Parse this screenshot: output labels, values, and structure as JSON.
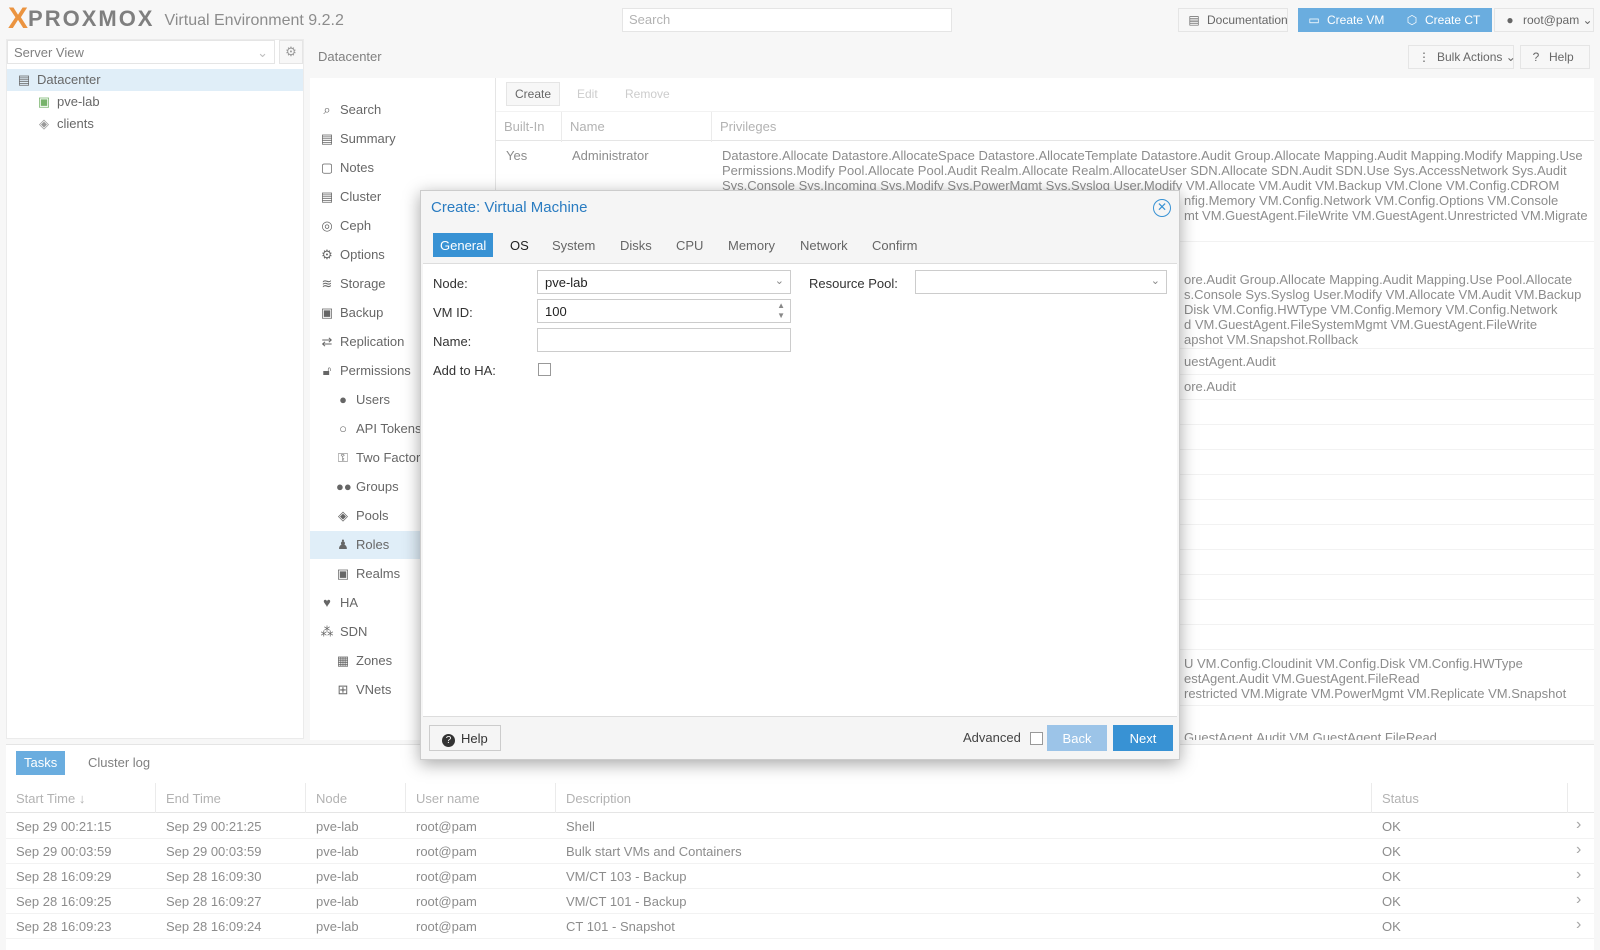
{
  "header": {
    "logo_x": "X",
    "logo_text": "PROXMOX",
    "product": "Virtual Environment 9.2.2",
    "search_placeholder": "Search",
    "documentation": "Documentation",
    "create_vm": "Create VM",
    "create_ct": "Create CT",
    "user": "root@pam"
  },
  "tree": {
    "view": "Server View",
    "items": [
      "Datacenter",
      "pve-lab",
      "clients"
    ]
  },
  "content": {
    "breadcrumb": "Datacenter",
    "bulk_actions": "Bulk Actions",
    "help": "Help"
  },
  "menu": [
    "Search",
    "Summary",
    "Notes",
    "Cluster",
    "Ceph",
    "Options",
    "Storage",
    "Backup",
    "Replication",
    "Permissions",
    "Users",
    "API Tokens",
    "Two Factor",
    "Groups",
    "Pools",
    "Roles",
    "Realms",
    "HA",
    "SDN",
    "Zones",
    "VNets"
  ],
  "roles_grid": {
    "toolbar": {
      "create": "Create",
      "edit": "Edit",
      "remove": "Remove"
    },
    "columns": [
      "Built-In",
      "Name",
      "Privileges"
    ],
    "row1": {
      "builtin": "Yes",
      "name": "Administrator",
      "privileges": "Datastore.Allocate Datastore.AllocateSpace Datastore.AllocateTemplate Datastore.Audit Group.Allocate Mapping.Audit Mapping.Modify Mapping.Use Permissions.Modify Pool.Allocate Pool.Audit Realm.Allocate Realm.AllocateUser SDN.Allocate SDN.Audit SDN.Use Sys.AccessNetwork Sys.Audit Sys.Console Sys.Incoming Sys.Modify Sys.PowerMgmt Sys.Syslog User.Modify VM.Allocate VM.Audit VM.Backup VM.Clone VM.Config.CDROM"
    },
    "row1_tail": "nfig.Memory VM.Config.Network VM.Config.Options VM.Console",
    "row1_tail2": "mt VM.GuestAgent.FileWrite VM.GuestAgent.Unrestricted VM.Migrate",
    "row2_lines": [
      "ore.Audit Group.Allocate Mapping.Audit Mapping.Use Pool.Allocate",
      "s.Console Sys.Syslog User.Modify VM.Allocate VM.Audit VM.Backup",
      "Disk VM.Config.HWType VM.Config.Memory VM.Config.Network",
      "d VM.GuestAgent.FileSystemMgmt VM.GuestAgent.FileWrite",
      "apshot VM.Snapshot.Rollback"
    ],
    "row3": "uestAgent.Audit",
    "row4": "ore.Audit",
    "row_lower_lines": [
      "U VM.Config.Cloudinit VM.Config.Disk VM.Config.HWType",
      "estAgent.Audit VM.GuestAgent.FileRead",
      "restricted VM.Migrate VM.PowerMgmt VM.Replicate VM.Snapshot"
    ],
    "row_last": "GuestAgent.Audit VM.GuestAgent.FileRead"
  },
  "dialog": {
    "title": "Create: Virtual Machine",
    "tabs": [
      "General",
      "OS",
      "System",
      "Disks",
      "CPU",
      "Memory",
      "Network",
      "Confirm"
    ],
    "node_label": "Node:",
    "node_value": "pve-lab",
    "vmid_label": "VM ID:",
    "vmid_value": "100",
    "name_label": "Name:",
    "name_value": "",
    "ha_label": "Add to HA:",
    "pool_label": "Resource Pool:",
    "pool_value": "",
    "help": "Help",
    "advanced": "Advanced",
    "back": "Back",
    "next": "Next"
  },
  "tasks": {
    "tabs": [
      "Tasks",
      "Cluster log"
    ],
    "columns": [
      "Start Time",
      "End Time",
      "Node",
      "User name",
      "Description",
      "Status"
    ],
    "rows": [
      [
        "Sep 29 00:21:15",
        "Sep 29 00:21:25",
        "pve-lab",
        "root@pam",
        "Shell",
        "OK"
      ],
      [
        "Sep 29 00:03:59",
        "Sep 29 00:03:59",
        "pve-lab",
        "root@pam",
        "Bulk start VMs and Containers",
        "OK"
      ],
      [
        "Sep 28 16:09:29",
        "Sep 28 16:09:30",
        "pve-lab",
        "root@pam",
        "VM/CT 103 - Backup",
        "OK"
      ],
      [
        "Sep 28 16:09:25",
        "Sep 28 16:09:27",
        "pve-lab",
        "root@pam",
        "VM/CT 101 - Backup",
        "OK"
      ],
      [
        "Sep 28 16:09:23",
        "Sep 28 16:09:24",
        "pve-lab",
        "root@pam",
        "CT 101 - Snapshot",
        "OK"
      ]
    ]
  },
  "colors": {
    "accent": "#3892d4",
    "brand": "#e57000",
    "selection": "#d6e8f6"
  }
}
